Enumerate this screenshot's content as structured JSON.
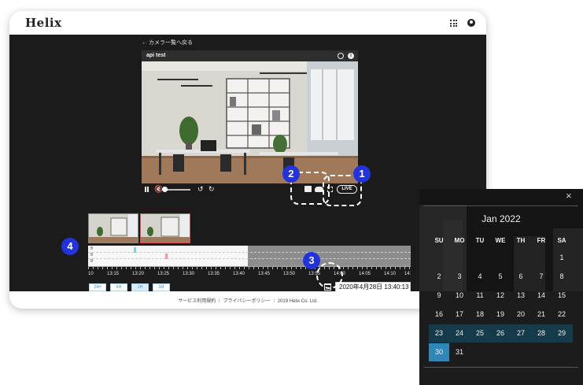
{
  "app": {
    "logo": "Helix"
  },
  "viewer": {
    "back_link": "← カメラ一覧へ戻る",
    "camera_name": "api test",
    "live_label": "LIVE"
  },
  "timeline": {
    "channel_labels": [
      "B",
      "B",
      "B"
    ],
    "tick_labels": [
      "10",
      "13:15",
      "13:20",
      "13:25",
      "13:30",
      "13:35",
      "13:40",
      "13:45",
      "13:50",
      "13:55",
      "14:00",
      "14:05",
      "14:10",
      "14:"
    ],
    "range_buttons": [
      "24H",
      "6H",
      "1H",
      "1M"
    ],
    "active_range": "1H",
    "datetime_value": "2020年4月28日 13:40:13"
  },
  "footer": {
    "text": "サービス利用規約 ｜ プライバシーポリシー ｜ 2019 Helix Co. Ltd."
  },
  "callouts": [
    "1",
    "2",
    "3",
    "4"
  ],
  "calendar": {
    "close": "×",
    "month_label": "Jan 2022",
    "weekdays": [
      "SU",
      "MO",
      "TU",
      "WE",
      "TH",
      "FR",
      "SA"
    ],
    "days": [
      "1",
      "2",
      "3",
      "4",
      "5",
      "6",
      "7",
      "8",
      "9",
      "10",
      "11",
      "12",
      "13",
      "14",
      "15",
      "16",
      "17",
      "18",
      "19",
      "20",
      "21",
      "22",
      "23",
      "24",
      "25",
      "26",
      "27",
      "28",
      "29",
      "30",
      "31"
    ],
    "first_weekday": 6,
    "highlighted_week": [
      "23",
      "24",
      "25",
      "26",
      "27",
      "28",
      "29"
    ],
    "selected_day": "30"
  },
  "colors": {
    "badge": "#2233dd",
    "calendar_week": "#153b4a",
    "calendar_selected": "#2f87b8",
    "clip_blue": "#7fd0e0",
    "clip_red": "#f09aa0"
  },
  "icons": [
    "grid-icon",
    "user-icon",
    "clock-icon",
    "info-icon",
    "pause-icon",
    "mute-icon",
    "rewind-icon",
    "forward-icon",
    "snapshot-icon",
    "cloud-icon",
    "fullscreen-icon",
    "calendar-icon",
    "close-icon"
  ]
}
